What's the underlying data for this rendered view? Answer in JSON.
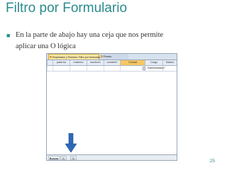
{
  "title": "Filtro por Formulario",
  "bullet": {
    "line1": "En la parte de abajo hay una ceja que nos permite",
    "line2": "aplicar una O lógica"
  },
  "screenshot": {
    "tabs": [
      {
        "label": "Empleados y Puestos: Filtro por formulario"
      },
      {
        "label": "Puesto"
      }
    ],
    "columns": [
      "paterno",
      "materno",
      "nombre1",
      "nombre2",
      "Ciudad",
      "Cargo",
      "Salario"
    ],
    "criteria_value": "\"Administrador\"",
    "bottom_tabs": [
      "Buscar",
      "Or",
      "Or"
    ]
  },
  "page_number": "25",
  "colors": {
    "accent": "#2b8a8c",
    "tab_active": "#fbe8a6",
    "header_hot": "#f6c761",
    "arrow": "#2f68b8"
  },
  "icons": [
    "square-bullet-icon",
    "table-icon",
    "dropdown-arrow-icon",
    "down-arrow-icon"
  ]
}
